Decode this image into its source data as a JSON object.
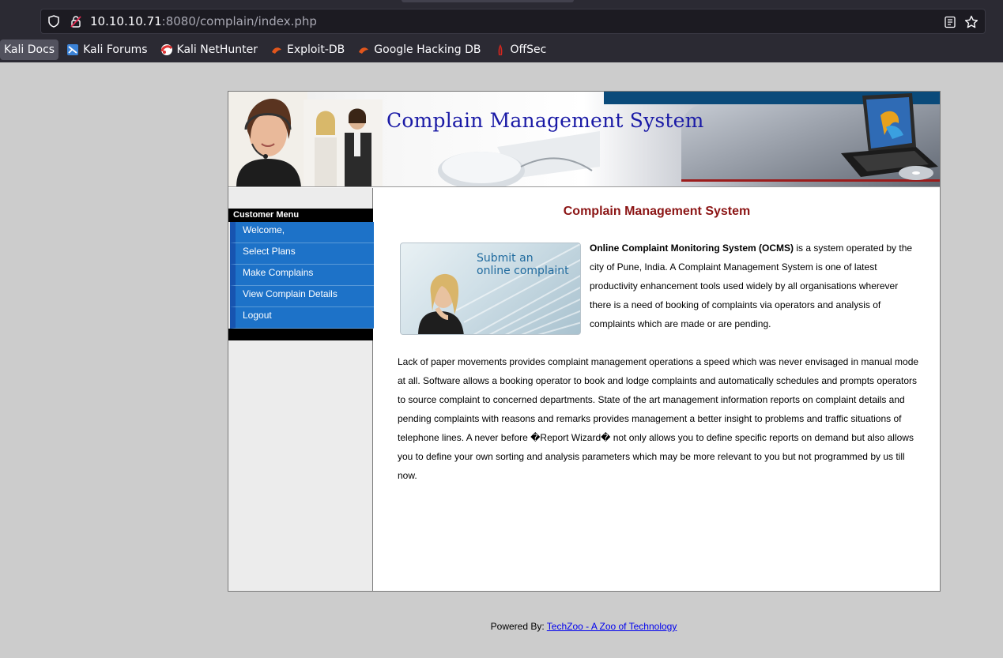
{
  "browser": {
    "url_host": "10.10.10.71",
    "url_rest": ":8080/complain/index.php",
    "bookmarks": [
      {
        "label": "Kali Docs",
        "icon": "kali-docs-icon"
      },
      {
        "label": "Kali Forums",
        "icon": "kali-forums-icon"
      },
      {
        "label": "Kali NetHunter",
        "icon": "nethunter-icon"
      },
      {
        "label": "Exploit-DB",
        "icon": "exploit-db-icon"
      },
      {
        "label": "Google Hacking DB",
        "icon": "ghdb-icon"
      },
      {
        "label": "OffSec",
        "icon": "offsec-icon"
      }
    ]
  },
  "banner": {
    "title": "Complain Management System"
  },
  "sidebar": {
    "heading": "Customer Menu",
    "items": [
      {
        "label": "Welcome,"
      },
      {
        "label": "Select Plans"
      },
      {
        "label": "Make Complains"
      },
      {
        "label": "View Complain Details"
      },
      {
        "label": "Logout"
      }
    ]
  },
  "main": {
    "title": "Complain Management System",
    "promo_line1": "Submit an",
    "promo_line2": "online complaint",
    "intro_bold": "Online Complaint Monitoring System (OCMS)",
    "intro_rest": " is a system operated by the city of Pune, India. A Complaint Management System is one of latest productivity enhancement tools used widely by all organisations wherever there is a need of booking of complaints via operators and analysis of complaints which are made or are pending.",
    "body": "Lack of paper movements provides complaint management operations a speed which was never envisaged in manual mode at all. Software allows a booking operator to book and lodge complaints and automatically schedules and prompts operators to source complaint to concerned departments. State of the art management information reports on complaint details and pending complaints with reasons and remarks provides management a better insight to problems and traffic situations of telephone lines. A never before �Report Wizard� not only allows you to define specific reports on demand but also allows you to define your own sorting and analysis parameters which may be more relevant to you but not programmed by us till now."
  },
  "footer": {
    "prefix": "Powered By: ",
    "link": "TechZoo - A Zoo of Technology"
  }
}
